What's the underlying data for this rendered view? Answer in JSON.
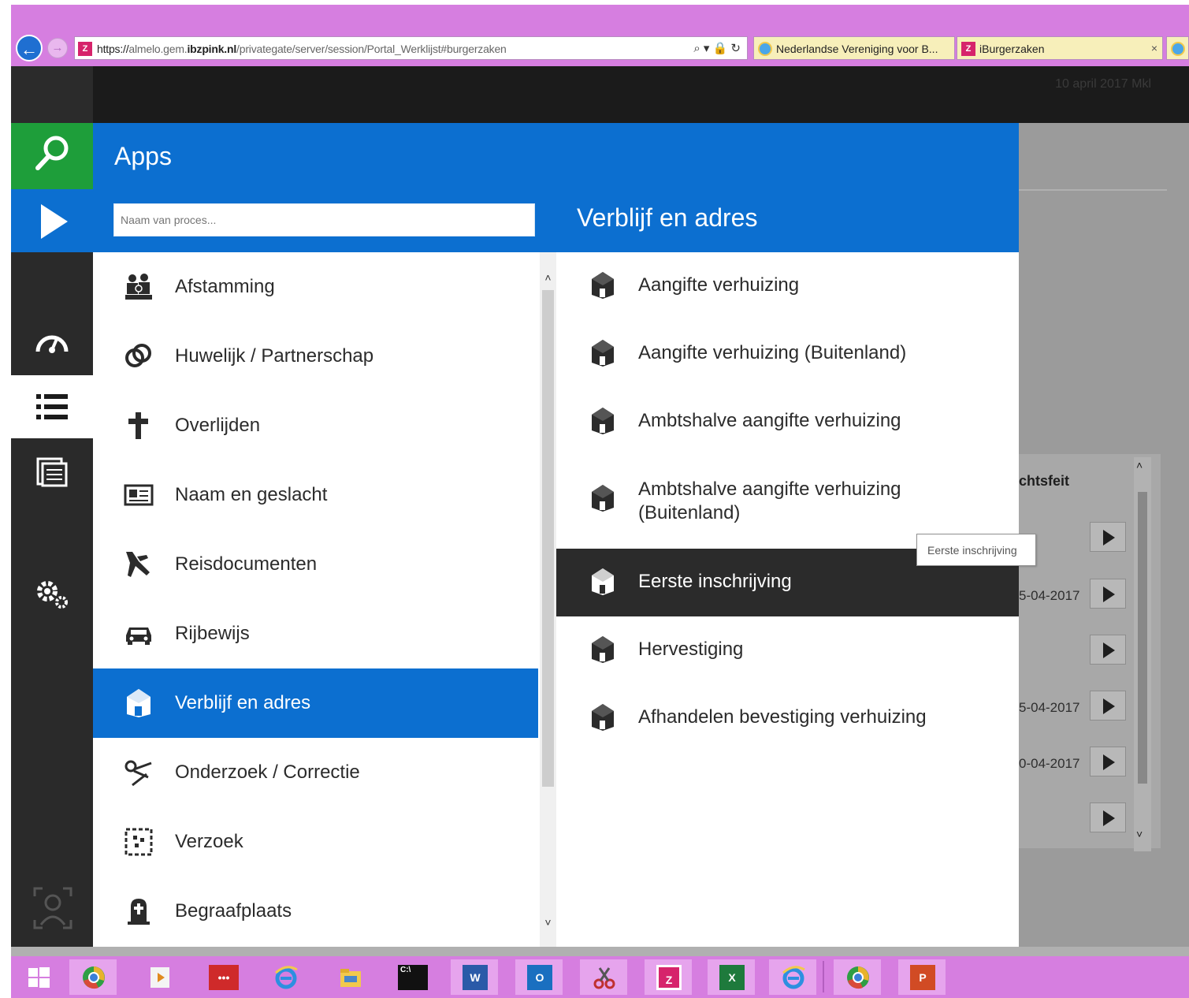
{
  "browser": {
    "url_prefix": "https://",
    "url_host_a": "almelo.gem.",
    "url_host_b": "ibzpink.nl",
    "url_path": "/privategate/server/session/Portal_Werklijst#burgerzaken",
    "addr_controls": "⌕ ▾ 🔒 ↻",
    "tabs": [
      {
        "label": "Nederlandse Vereniging voor B..."
      },
      {
        "label": "iBurgerzaken"
      }
    ],
    "tab_close": "×"
  },
  "header": {
    "date_text": "10 april 2017 Mkl"
  },
  "apps_panel": {
    "title": "Apps",
    "search_placeholder": "Naam van proces...",
    "items": [
      {
        "label": "Afstamming",
        "icon": "family-icon"
      },
      {
        "label": "Huwelijk / Partnerschap",
        "icon": "rings-icon"
      },
      {
        "label": "Overlijden",
        "icon": "cross-icon"
      },
      {
        "label": "Naam en geslacht",
        "icon": "id-card-icon"
      },
      {
        "label": "Reisdocumenten",
        "icon": "airplane-icon"
      },
      {
        "label": "Rijbewijs",
        "icon": "car-icon"
      },
      {
        "label": "Verblijf en adres",
        "icon": "house-icon",
        "active": true
      },
      {
        "label": "Onderzoek / Correctie",
        "icon": "scissors-icon"
      },
      {
        "label": "Verzoek",
        "icon": "request-icon"
      },
      {
        "label": "Begraafplaats",
        "icon": "grave-icon"
      }
    ],
    "scroll_up": "˄",
    "scroll_down": "˅"
  },
  "process_panel": {
    "title": "Verblijf en adres",
    "items": [
      {
        "label": "Aangifte verhuizing"
      },
      {
        "label": "Aangifte verhuizing (Buitenland)"
      },
      {
        "label": "Ambtshalve aangifte verhuizing"
      },
      {
        "label": "Ambtshalve aangifte verhuizing (Buitenland)"
      },
      {
        "label": "Eerste inschrijving",
        "active": true
      },
      {
        "label": "Hervestiging"
      },
      {
        "label": "Afhandelen bevestiging verhuizing"
      }
    ]
  },
  "tooltip": {
    "text": "Eerste inschrijving"
  },
  "background": {
    "column_header": "chtsfeit",
    "dates": [
      "5-04-2017",
      "5-04-2017",
      "0-04-2017"
    ],
    "scroll_up": "˄",
    "scroll_down": "˅"
  },
  "taskbar": {
    "apps": [
      "windows-start-icon",
      "chrome-icon",
      "media-player-icon",
      "dots-app-icon",
      "internet-explorer-icon",
      "file-explorer-icon",
      "cmd-icon",
      "word-icon",
      "outlook-icon",
      "snipping-tool-icon",
      "pink-app-icon",
      "excel-icon",
      "internet-explorer-icon",
      "chrome-icon",
      "powerpoint-icon"
    ],
    "labels": {
      "dots": "•••",
      "cmd": "C:\\",
      "word": "W",
      "outlook": "O",
      "pink": "Z",
      "excel": "X",
      "ppt": "P"
    }
  },
  "colors": {
    "chrome_purple": "#d67ee0",
    "brand_blue": "#0c6fd0",
    "search_green": "#1e9e3a",
    "rail_dark": "#2a2a2a",
    "active_dark": "#2b2b2b"
  }
}
